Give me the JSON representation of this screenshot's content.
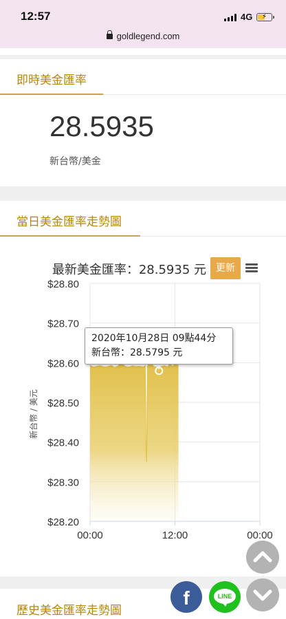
{
  "status_bar": {
    "time": "12:57",
    "network": "4G",
    "url": "goldlegend.com"
  },
  "rate_section": {
    "title": "即時美金匯率",
    "value": "28.5935",
    "unit": "新台幣/美金"
  },
  "chart_section": {
    "title": "當日美金匯率走勢圖",
    "heading": "最新美金匯率：28.5935 元",
    "update_label": "更新",
    "tooltip": {
      "line1": "2020年10月28日 09點44分",
      "line2": "新台幣：28.5795 元"
    }
  },
  "history_section": {
    "title": "歷史美金匯率走勢圖"
  },
  "colors": {
    "accent": "#b8860b",
    "button": "#e8a94a",
    "area": "#e1c04a",
    "facebook": "#3b5b99",
    "line": "#1fc11f"
  },
  "icons": [
    "lock-icon",
    "signal-icon",
    "battery-icon",
    "menu-icon",
    "facebook-icon",
    "line-icon",
    "chevron-up-icon",
    "chevron-down-icon"
  ],
  "chart_data": {
    "type": "area",
    "title": "最新美金匯率：28.5935 元",
    "ylabel": "新台幣 / 美元",
    "xlabel": "",
    "x_tick_labels": [
      "00:00",
      "12:00",
      "00:00"
    ],
    "y_tick_labels": [
      "$28.80",
      "$28.70",
      "$28.60",
      "$28.50",
      "$28.40",
      "$28.30",
      "$28.20"
    ],
    "y_ticks": [
      28.8,
      28.7,
      28.6,
      28.5,
      28.4,
      28.3,
      28.2
    ],
    "ylim": [
      28.2,
      28.8
    ],
    "xlim_hours": [
      0,
      24
    ],
    "grid": true,
    "series": [
      {
        "x_hours": [
          0,
          0.5,
          1,
          1.5,
          2,
          2.5,
          3,
          3.5,
          4,
          4.3,
          4.6,
          5,
          5.5,
          6,
          6.5,
          7,
          7.5,
          7.8,
          7.9,
          8.0,
          8.1,
          8.5,
          9,
          9.5,
          9.74,
          10,
          10.5,
          11,
          11.3,
          11.6,
          12,
          12.3,
          12.5
        ],
        "values": [
          28.593,
          28.589,
          28.591,
          28.592,
          28.589,
          28.59,
          28.593,
          28.588,
          28.592,
          28.6,
          28.597,
          28.59,
          28.589,
          28.592,
          28.59,
          28.591,
          28.589,
          28.592,
          28.38,
          28.35,
          28.59,
          28.602,
          28.59,
          28.588,
          28.5795,
          28.59,
          28.592,
          28.589,
          28.6,
          28.59,
          28.596,
          28.594,
          28.5935
        ]
      }
    ],
    "tooltip_point": {
      "x_hours": 9.74,
      "value": 28.5795
    }
  }
}
